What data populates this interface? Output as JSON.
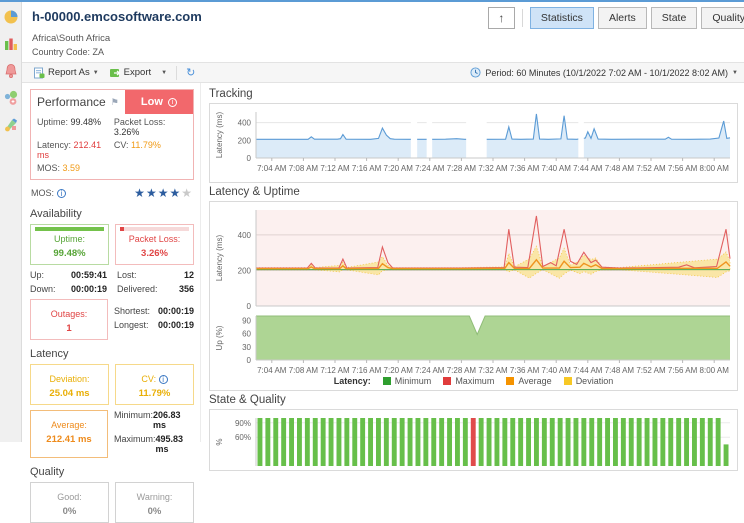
{
  "window": {
    "title": "h-00000.emcosoftware.com",
    "group_path": "Africa\\South Africa",
    "country_code": "Country Code: ZA"
  },
  "tabs": {
    "back_icon": "↑",
    "items": [
      "Statistics",
      "Alerts",
      "State",
      "Quality"
    ],
    "active": "Statistics"
  },
  "toolbar": {
    "report_as_label": "Report As",
    "export_label": "Export",
    "refresh_icon": "↻",
    "period_label": "Period: 60 Minutes (10/1/2022 7:02 AM - 10/1/2022 8:02 AM)"
  },
  "performance": {
    "title": "Performance",
    "badge": "Low",
    "uptime_label": "Uptime:",
    "uptime_value": "99.48%",
    "packet_loss_label": "Packet Loss:",
    "packet_loss_value": "3.26%",
    "latency_label": "Latency:",
    "latency_value": "212.41 ms",
    "cv_label": "CV:",
    "cv_value": "11.79%",
    "mos_label": "MOS:",
    "mos_value": "3.59",
    "mos_row_label": "MOS:",
    "stars_filled": 4,
    "stars_total": 5
  },
  "availability": {
    "title": "Availability",
    "uptime_label": "Uptime:",
    "uptime_value": "99.48%",
    "uptime_bar_pct": 100,
    "packet_label": "Packet Loss:",
    "packet_value": "3.26%",
    "packet_bar_pct": 6,
    "up_label": "Up:",
    "up_value": "00:59:41",
    "down_label": "Down:",
    "down_value": "00:00:19",
    "lost_label": "Lost:",
    "lost_value": "12",
    "delivered_label": "Delivered:",
    "delivered_value": "356",
    "outages_label": "Outages:",
    "outages_value": "1",
    "shortest_label": "Shortest:",
    "shortest_value": "00:00:19",
    "longest_label": "Longest:",
    "longest_value": "00:00:19"
  },
  "latency_section": {
    "title": "Latency",
    "deviation_label": "Deviation:",
    "deviation_value": "25.04 ms",
    "cv_label": "CV:",
    "cv_value": "11.79%",
    "average_label": "Average:",
    "average_value": "212.41 ms",
    "minimum_label": "Minimum:",
    "minimum_value": "206.83 ms",
    "maximum_label": "Maximum:",
    "maximum_value": "495.83 ms"
  },
  "quality_section": {
    "title": "Quality",
    "good_label": "Good:",
    "good_value": "0%",
    "warning_label": "Warning:",
    "warning_value": "0%"
  },
  "colors": {
    "accent_blue": "#5b9bd5",
    "good_green": "#70c14a",
    "alert_red": "#e04545",
    "average_orange": "#ef941f",
    "deviation_yellow": "#f2c53d"
  },
  "chart_data": [
    {
      "type": "area",
      "title": "Tracking",
      "ylabel": "Latency (ms)",
      "yticks": [
        0,
        200,
        400
      ],
      "ylim": [
        0,
        520
      ],
      "xticks": [
        "7:04 AM",
        "7:08 AM",
        "7:12 AM",
        "7:16 AM",
        "7:20 AM",
        "7:24 AM",
        "7:28 AM",
        "7:32 AM",
        "7:36 AM",
        "7:40 AM",
        "7:44 AM",
        "7:48 AM",
        "7:52 AM",
        "7:56 AM",
        "8:00 AM"
      ],
      "x_tick_minutes": [
        2,
        6,
        10,
        14,
        18,
        22,
        26,
        30,
        34,
        38,
        42,
        46,
        50,
        54,
        58
      ],
      "x_range_minutes": [
        0,
        60
      ],
      "line_color": "#5b9bd5",
      "fill_color": "#dcebf8",
      "points": [
        [
          0,
          211
        ],
        [
          5,
          211
        ],
        [
          6.6,
          211
        ],
        [
          7,
          240
        ],
        [
          7.4,
          212
        ],
        [
          10.3,
          212
        ],
        [
          10.7,
          218
        ],
        [
          11,
          266
        ],
        [
          11.4,
          212
        ],
        [
          14.5,
          211
        ],
        [
          15.5,
          222
        ],
        [
          16,
          338
        ],
        [
          16.5,
          258
        ],
        [
          17,
          218
        ],
        [
          17.5,
          212
        ],
        [
          19.4,
          211
        ],
        [
          20.6,
          211
        ],
        [
          21.4,
          211
        ],
        [
          22.5,
          211
        ],
        [
          24,
          212
        ],
        [
          25.4,
          218
        ],
        [
          26.4,
          211
        ],
        [
          29.4,
          211
        ],
        [
          31.6,
          212
        ],
        [
          32,
          352
        ],
        [
          32.4,
          214
        ],
        [
          33.5,
          211
        ],
        [
          35.1,
          214
        ],
        [
          35.5,
          498
        ],
        [
          35.9,
          214
        ],
        [
          37,
          211
        ],
        [
          38.6,
          216
        ],
        [
          39,
          478
        ],
        [
          39.4,
          214
        ],
        [
          40.6,
          211
        ],
        [
          41.7,
          226
        ],
        [
          42,
          296
        ],
        [
          42.4,
          222
        ],
        [
          42.8,
          330
        ],
        [
          43.3,
          214
        ],
        [
          45,
          211
        ],
        [
          48,
          212
        ],
        [
          51.8,
          212
        ],
        [
          52.2,
          234
        ],
        [
          52.6,
          212
        ],
        [
          55,
          211
        ],
        [
          57.5,
          214
        ],
        [
          58.6,
          226
        ],
        [
          59.2,
          418
        ],
        [
          59.6,
          222
        ],
        [
          60,
          228
        ]
      ],
      "gaps_minutes": [
        [
          19.6,
          20.4
        ],
        [
          21.6,
          22.3
        ],
        [
          26.6,
          29.2
        ],
        [
          40.8,
          41.5
        ]
      ]
    },
    {
      "type": "line-multi",
      "title": "Latency & Uptime",
      "latency_panel": {
        "ylabel": "Latency (ms)",
        "yticks": [
          0,
          200,
          400
        ],
        "ylim": [
          0,
          540
        ],
        "bg": "#fcf0ef",
        "maximum": {
          "color": "#e15f5f",
          "points": [
            [
              0,
              213
            ],
            [
              6.5,
              213
            ],
            [
              7,
              240
            ],
            [
              7.5,
              214
            ],
            [
              10.5,
              214
            ],
            [
              11,
              264
            ],
            [
              11.5,
              214
            ],
            [
              15.4,
              216
            ],
            [
              16,
              332
            ],
            [
              16.7,
              244
            ],
            [
              17.3,
              214
            ],
            [
              20,
              213
            ],
            [
              26,
              213
            ],
            [
              31.4,
              216
            ],
            [
              32,
              432
            ],
            [
              32.7,
              218
            ],
            [
              34.4,
              216
            ],
            [
              35.5,
              506
            ],
            [
              36.3,
              222
            ],
            [
              37.3,
              244
            ],
            [
              38,
              226
            ],
            [
              39,
              432
            ],
            [
              39.8,
              252
            ],
            [
              40.6,
              234
            ],
            [
              41.5,
              302
            ],
            [
              42.4,
              244
            ],
            [
              43,
              258
            ],
            [
              43.8,
              218
            ],
            [
              46,
              213
            ],
            [
              53.5,
              218
            ],
            [
              54.5,
              232
            ],
            [
              55.5,
              215
            ],
            [
              58.3,
              222
            ],
            [
              59.5,
              432
            ],
            [
              60,
              266
            ]
          ]
        },
        "average": {
          "color": "#ef941f",
          "points": [
            [
              0,
              210
            ],
            [
              6.6,
              210
            ],
            [
              7,
              220
            ],
            [
              7.4,
              210
            ],
            [
              10.6,
              210
            ],
            [
              11,
              226
            ],
            [
              11.4,
              210
            ],
            [
              15.5,
              211
            ],
            [
              16,
              238
            ],
            [
              16.7,
              216
            ],
            [
              17.3,
              210
            ],
            [
              26,
              210
            ],
            [
              31.5,
              212
            ],
            [
              32,
              244
            ],
            [
              32.7,
              212
            ],
            [
              34.6,
              211
            ],
            [
              35.5,
              260
            ],
            [
              36.3,
              213
            ],
            [
              38.4,
              214
            ],
            [
              39,
              252
            ],
            [
              39.8,
              216
            ],
            [
              41,
              218
            ],
            [
              41.5,
              240
            ],
            [
              42.4,
              220
            ],
            [
              43,
              232
            ],
            [
              43.8,
              211
            ],
            [
              46,
              210
            ],
            [
              54,
              212
            ],
            [
              58.4,
              212
            ],
            [
              59.5,
              248
            ],
            [
              60,
              224
            ]
          ]
        },
        "minimum": {
          "color": "#4ca64c",
          "points": [
            [
              0,
              205
            ],
            [
              60,
              205
            ]
          ]
        },
        "deviation": {
          "color": "#f2c53d",
          "fill": "#fae49e",
          "halfwidth_points": [
            [
              0,
              6
            ],
            [
              6.6,
              6
            ],
            [
              7,
              14
            ],
            [
              7.4,
              6
            ],
            [
              11,
              20
            ],
            [
              11.4,
              6
            ],
            [
              16,
              40
            ],
            [
              16.7,
              12
            ],
            [
              17.3,
              6
            ],
            [
              26,
              6
            ],
            [
              31.5,
              8
            ],
            [
              32,
              52
            ],
            [
              32.7,
              8
            ],
            [
              35.5,
              76
            ],
            [
              36.3,
              8
            ],
            [
              39,
              72
            ],
            [
              39.8,
              14
            ],
            [
              41.5,
              46
            ],
            [
              43,
              38
            ],
            [
              43.8,
              8
            ],
            [
              46,
              6
            ],
            [
              59.5,
              56
            ],
            [
              60,
              26
            ]
          ]
        }
      },
      "up_panel": {
        "ylabel": "Up (%)",
        "yticks": [
          0,
          30,
          60,
          90
        ],
        "ylim": [
          0,
          100
        ],
        "fill": "#aed594",
        "outline": "#90bd78",
        "points": [
          [
            0,
            100
          ],
          [
            27,
            100
          ],
          [
            28,
            58
          ],
          [
            29,
            100
          ],
          [
            60,
            100
          ]
        ],
        "outage_marker_minute": 28
      },
      "xticks": [
        "7:04 AM",
        "7:08 AM",
        "7:12 AM",
        "7:16 AM",
        "7:20 AM",
        "7:24 AM",
        "7:28 AM",
        "7:32 AM",
        "7:36 AM",
        "7:40 AM",
        "7:44 AM",
        "7:48 AM",
        "7:52 AM",
        "7:56 AM",
        "8:00 AM"
      ],
      "x_tick_minutes": [
        2,
        6,
        10,
        14,
        18,
        22,
        26,
        30,
        34,
        38,
        42,
        46,
        50,
        54,
        58
      ],
      "x_range_minutes": [
        0,
        60
      ],
      "legend": {
        "label": "Latency:",
        "items": [
          {
            "name": "Minimum",
            "color": "#2f9e2f"
          },
          {
            "name": "Maximum",
            "color": "#e03c3c"
          },
          {
            "name": "Average",
            "color": "#f59300"
          },
          {
            "name": "Deviation",
            "color": "#f7c825"
          }
        ]
      }
    },
    {
      "type": "bar",
      "title": "State & Quality",
      "ylabel": "%",
      "ytick_values": [
        90,
        60
      ],
      "ytick_labels": [
        "90%",
        "60%"
      ],
      "ylim": [
        0,
        100
      ],
      "bar_color": "#67bf4a",
      "bad_color": "#e04b4b",
      "red_indexes": [
        27
      ],
      "values": [
        100,
        100,
        100,
        100,
        100,
        100,
        100,
        100,
        100,
        100,
        100,
        100,
        100,
        100,
        100,
        100,
        100,
        100,
        100,
        100,
        100,
        100,
        100,
        100,
        100,
        100,
        100,
        100,
        100,
        100,
        100,
        100,
        100,
        100,
        100,
        100,
        100,
        100,
        100,
        100,
        100,
        100,
        100,
        100,
        100,
        100,
        100,
        100,
        100,
        100,
        100,
        100,
        100,
        100,
        100,
        100,
        100,
        100,
        100,
        45
      ]
    }
  ]
}
